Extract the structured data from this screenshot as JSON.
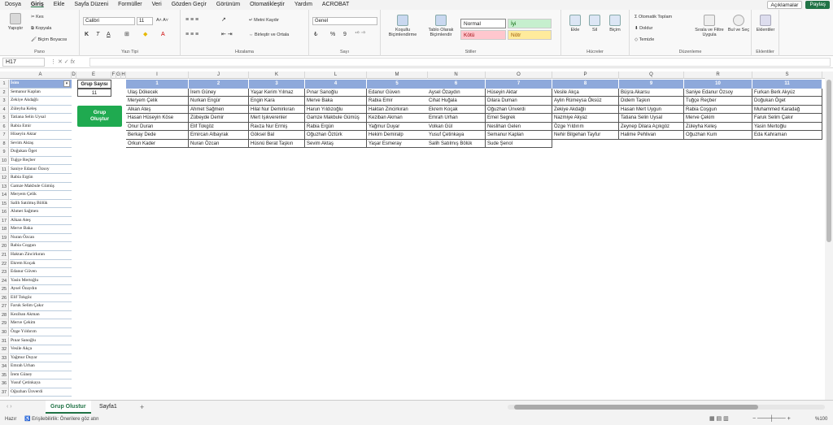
{
  "menu": {
    "items": [
      "Dosya",
      "Giriş",
      "Ekle",
      "Sayfa Düzeni",
      "Formüller",
      "Veri",
      "Gözden Geçir",
      "Görünüm",
      "Otomatikleştir",
      "Yardım",
      "ACROBAT"
    ],
    "comments": "Açıklamalar",
    "share": "Paylaş"
  },
  "ribbon": {
    "clipboard": {
      "paste": "Yapıştır",
      "cut": "Kes",
      "copy": "Kopyala",
      "painter": "Biçim Boyacısı",
      "label": "Pano"
    },
    "font": {
      "name": "Calibri",
      "size": "11",
      "label": "Yazı Tipi",
      "bold": "K",
      "italic": "T",
      "underline": "A"
    },
    "align": {
      "wrap": "Metni Kaydır",
      "merge": "Birleştir ve Ortala",
      "label": "Hizalama"
    },
    "number": {
      "format": "Genel",
      "pct": "%",
      "comma": "9",
      "label": "Sayı"
    },
    "styles": {
      "cond": "Koşullu Biçimlendirme",
      "table": "Tablo Olarak Biçimlendir",
      "normal": "Normal",
      "iyi": "İyi",
      "kotu": "Kötü",
      "notr": "Nötr",
      "label": "Stiller"
    },
    "cells": {
      "insert": "Ekle",
      "delete": "Sil",
      "format": "Biçim",
      "label": "Hücreler"
    },
    "editing": {
      "autosum": "Otomatik Toplam",
      "fill": "Doldur",
      "clear": "Temizle",
      "sort": "Sırala ve Filtre Uygula",
      "find": "Bul ve Seç",
      "label": "Düzenleme"
    },
    "addins": {
      "btn": "Eklentiler",
      "label": "Eklentiler"
    }
  },
  "formula": {
    "namebox": "H17",
    "fx": "fx"
  },
  "columns": [
    "A",
    "D",
    "E",
    "F",
    "G",
    "H",
    "I",
    "J",
    "K",
    "L",
    "M",
    "N",
    "O",
    "P",
    "Q",
    "R",
    "S"
  ],
  "colA": {
    "header": "İsim",
    "names": [
      "Semanur Kaplan",
      "Zekiye Akdağlı",
      "Züleyha Keleş",
      "Tatiana Selin Uysal",
      "Rabia Emir",
      "Hüseyin Aktar",
      "Sevim Aktaş",
      "Doğukan Öget",
      "Tuğçe Reçber",
      "Saniye Edanur Özsoy",
      "Rabia Ergün",
      "Gamze Makbule Gümüş",
      "Meryem Çelik",
      "Salih Satılmış Bölük",
      "Ahmet Sağmen",
      "Alkan Ateş",
      "Merve Baka",
      "Nuran Özcan",
      "Rabia Coşgun",
      "Haktan Zincirkıran",
      "Ekrem Koçak",
      "Edanur Güven",
      "Yasin Mertoğlu",
      "Aysel Özaydın",
      "Elif Tokgöz",
      "Faruk Selim Çakır",
      "Keziban Akman",
      "Merve Çekim",
      "Özge Yıldırım",
      "Pınar Sanoğlu",
      "Vesile Akça",
      "Yağmur Duyar",
      "Emrah Urhan",
      "İrem Güney",
      "Yusuf Çetinkaya",
      "Oğuzhan Ünverdi"
    ]
  },
  "groupBox": {
    "label": "Grup Sayısı",
    "value": "11",
    "button": "Grup Oluştur"
  },
  "groups": [
    {
      "n": "1",
      "members": [
        "Ulaş Dökecek",
        "Meryem Çelik",
        "Alkan Ateş",
        "Hasan Hüseyin Köse",
        "Onur Duran",
        "Berkay Dede",
        "Orkun Kader"
      ]
    },
    {
      "n": "2",
      "members": [
        "İrem Güney",
        "Nurkan Engür",
        "Ahmet Sağmen",
        "Zübeyde Demir",
        "Elif Tokgöz",
        "Emircan Albayrak",
        "Nuran Özcan"
      ]
    },
    {
      "n": "3",
      "members": [
        "Yaşar Kerim Yılmaz",
        "Engin Kara",
        "Hilal Nur Demirkıran",
        "Mert Işıkverenler",
        "Ravza Nur Ermiş",
        "Göksel Bal",
        "Hüsnü Berat Taşkın"
      ]
    },
    {
      "n": "4",
      "members": [
        "Pınar Sanoğlu",
        "Merve Baka",
        "Harun Yıldızoğlu",
        "Gamze Makbule Gümüş",
        "Rabia Ergün",
        "Oğuzhan Öztürk",
        "Sevim Aktaş"
      ]
    },
    {
      "n": "5",
      "members": [
        "Edanur Güven",
        "Rabia Emir",
        "Haktan Zincirkıran",
        "Keziban Akman",
        "Yağmur Duyar",
        "Hekim Demiralp",
        "Yaşar Esmeray"
      ]
    },
    {
      "n": "6",
      "members": [
        "Aysel Özaydın",
        "Cihat Huğala",
        "Ekrem Koçak",
        "Emrah Urhan",
        "Volkan Gül",
        "Yusuf Çetinkaya",
        "Salih Satılmış Bölük"
      ]
    },
    {
      "n": "7",
      "members": [
        "Hüseyin Aktar",
        "Dilara Duman",
        "Oğuzhan Ünverdi",
        "Emel Segrek",
        "Neslihan Gelen",
        "Semanur Kaplan",
        "Sude Şenol"
      ]
    },
    {
      "n": "8",
      "members": [
        "Vesile Akça",
        "Aylin Rümeysa Öksüz",
        "Zekiye Akdağlı",
        "Nazmiye Akyaz",
        "Özge Yıldırım",
        "Nehir Bilgehan Tayfur"
      ]
    },
    {
      "n": "9",
      "members": [
        "Büşra Akarsu",
        "Didem Taşkın",
        "Hasan Mert Uygun",
        "Tatiana Selin Uysal",
        "Zeynep Dilara Açıkgöz",
        "Halime Pehlivan"
      ]
    },
    {
      "n": "10",
      "members": [
        "Saniye Edanur Özsoy",
        "Tuğçe Reçber",
        "Rabia Coşgun",
        "Merve Çekim",
        "Züleyha Keleş",
        "Oğuzhan Kum"
      ]
    },
    {
      "n": "11",
      "members": [
        "Furkan Berk Akyüz",
        "Doğukan Öget",
        "Muhammed Karadağ",
        "Faruk Selim Çakır",
        "Yasin Mertoğlu",
        "Eda Kahraman"
      ]
    }
  ],
  "tabs": [
    "Grup Olustur",
    "Sayfa1"
  ],
  "status": {
    "ready": "Hazır",
    "access": "Erişilebilirlik: Önerilere göz atın",
    "zoom": "%100"
  }
}
